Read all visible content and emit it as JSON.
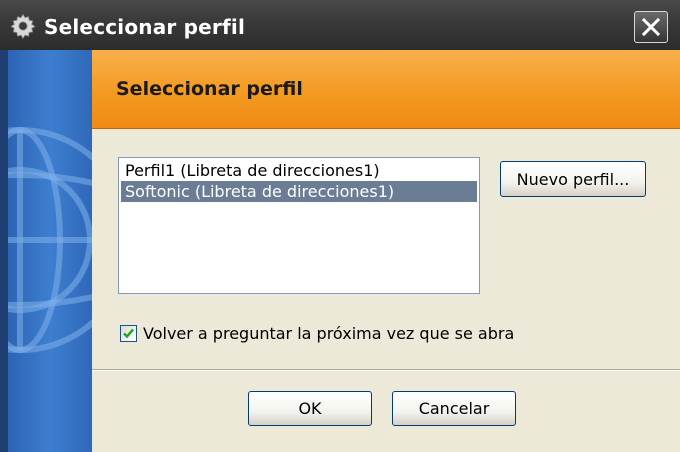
{
  "window": {
    "title": "Seleccionar perfil",
    "title_icon": "gear-icon",
    "close_icon": "close-icon"
  },
  "header": {
    "title": "Seleccionar perfil"
  },
  "profiles": {
    "items": [
      {
        "label": "Perfil1 (Libreta de direcciones1)",
        "selected": false
      },
      {
        "label": "Softonic (Libreta de direcciones1)",
        "selected": true
      }
    ]
  },
  "buttons": {
    "new_profile": "Nuevo perfil...",
    "ok": "OK",
    "cancel": "Cancelar"
  },
  "ask_again": {
    "label": "Volver a preguntar la próxima vez que se abra",
    "checked": true
  },
  "colors": {
    "header_orange": "#F39A22",
    "side_blue": "#3D7ED0",
    "selection": "#6B7D95",
    "dialog_bg": "#ECE9D8"
  }
}
